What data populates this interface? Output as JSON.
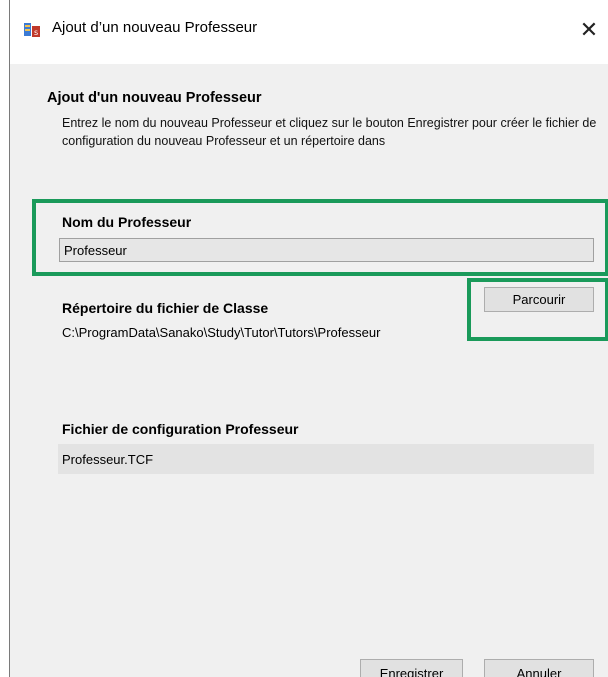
{
  "window": {
    "title": "Ajout d’un nouveau Professeur",
    "close_glyph": "✕"
  },
  "header": {
    "title": "Ajout d'un nouveau Professeur",
    "description": "Entrez le nom du nouveau Professeur et cliquez sur le bouton Enregistrer pour créer le fichier de configuration du nouveau Professeur et un répertoire dans"
  },
  "form": {
    "name_label": "Nom du Professeur",
    "name_value": "Professeur",
    "dir_label": "Répertoire du fichier de Classe",
    "dir_path": "C:\\ProgramData\\Sanako\\Study\\Tutor\\Tutors\\Professeur",
    "browse_label": "Parcourir",
    "config_label": "Fichier de configuration Professeur",
    "config_value": "Professeur.TCF"
  },
  "footer": {
    "save_label": "Enregistrer",
    "cancel_label": "Annuler"
  },
  "colors": {
    "highlight": "#1a9a5a",
    "dialog_bg": "#f0f0f0"
  },
  "icons": {
    "app": "sanako-app-icon",
    "close": "close-icon"
  }
}
